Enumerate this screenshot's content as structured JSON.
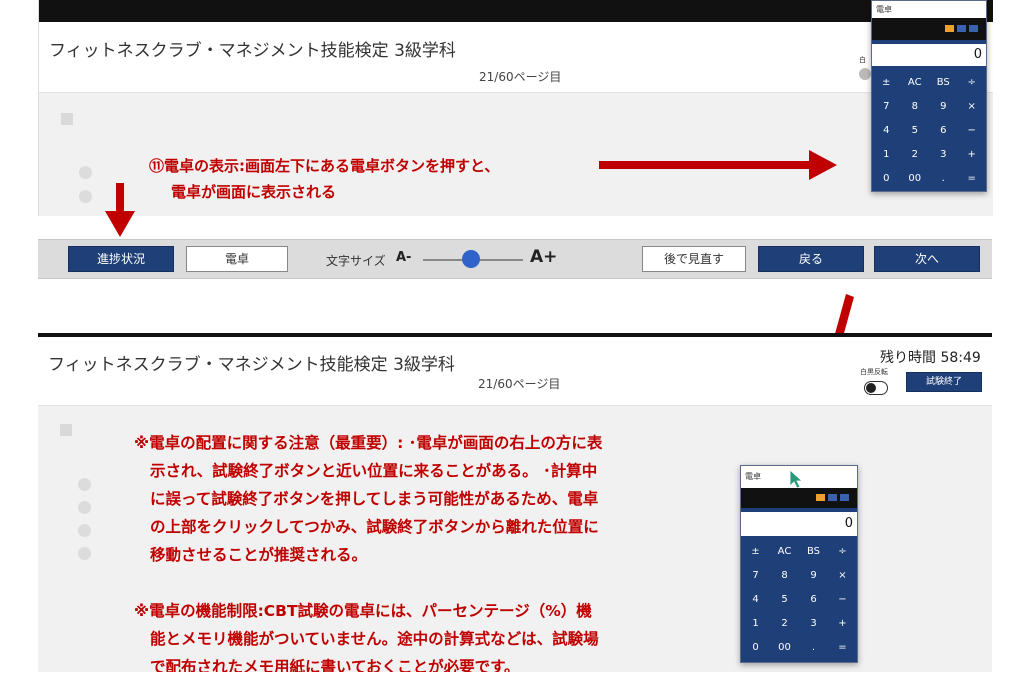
{
  "exam": {
    "title": "フィットネスクラブ・マネジメント技能検定 3級学科",
    "page": "21/60ページ目"
  },
  "annotation_11": {
    "line1": "⑪電卓の表示:画面左下にある電卓ボタンを押すと、",
    "line2": "電卓が画面に表示される"
  },
  "toolbar": {
    "progress": "進捗状況",
    "calculator": "電卓",
    "font_size_label": "文字サイズ",
    "font_minus": "A-",
    "font_plus": "A+",
    "review_later": "後で見直す",
    "back": "戻る",
    "next": "次へ"
  },
  "header": {
    "remaining_time": "残り時間 58:49",
    "toggle_label": "白黒反転",
    "end_exam": "試験終了"
  },
  "calculator": {
    "title": "電卓",
    "display": "0",
    "keys": [
      "±",
      "AC",
      "BS",
      "÷",
      "7",
      "8",
      "9",
      "×",
      "4",
      "5",
      "6",
      "−",
      "1",
      "2",
      "3",
      "+",
      "0",
      "00",
      ".",
      "="
    ]
  },
  "notes": {
    "placement": [
      "※電卓の配置に関する注意（最重要）: ･電卓が画面の右上の方に表",
      "示され、試験終了ボタンと近い位置に来ることがある。 ･計算中",
      "に誤って試験終了ボタンを押してしまう可能性があるため、電卓",
      "の上部をクリックしてつかみ、試験終了ボタンから離れた位置に",
      "移動させることが推奨される。"
    ],
    "limits": [
      "※電卓の機能制限:CBT試験の電卓には、パーセンテージ（%）機",
      "能とメモリ機能がついていません。途中の計算式などは、試験場",
      "で配布されたメモ用紙に書いておくことが必要です。"
    ]
  },
  "colors": {
    "accent_red": "#c00000",
    "button_blue": "#1e3f78"
  }
}
